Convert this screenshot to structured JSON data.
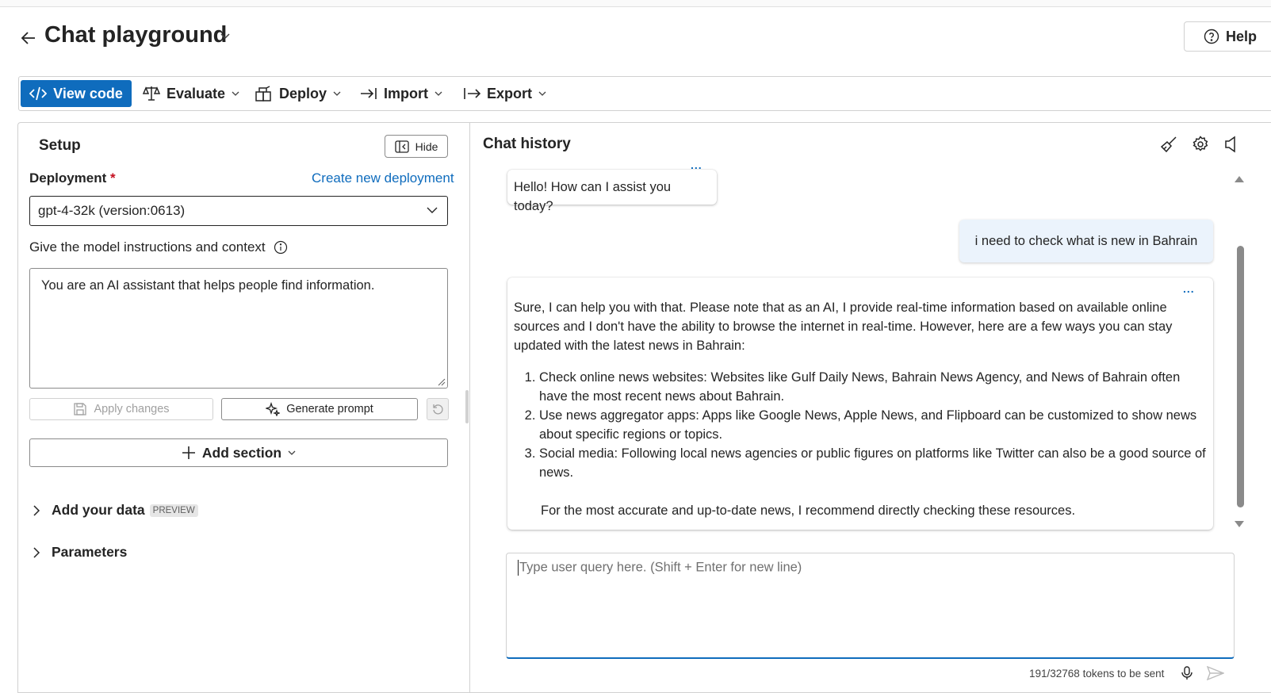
{
  "header": {
    "title": "Chat playground",
    "help_label": "Help"
  },
  "toolbar": {
    "view_code": "View code",
    "evaluate": "Evaluate",
    "deploy": "Deploy",
    "import": "Import",
    "export": "Export"
  },
  "setup": {
    "title": "Setup",
    "hide_label": "Hide",
    "deployment_label": "Deployment",
    "required_mark": "*",
    "create_link": "Create new deployment",
    "deployment_value": "gpt-4-32k (version:0613)",
    "instructions_label": "Give the model instructions and context",
    "system_message": "You are an AI assistant that helps people find information.",
    "apply_changes": "Apply changes",
    "generate_prompt": "Generate prompt",
    "add_section": "Add section",
    "add_your_data": "Add your data",
    "preview_badge": "PREVIEW",
    "parameters": "Parameters"
  },
  "chat": {
    "title": "Chat history",
    "messages": [
      {
        "role": "assistant",
        "text": "Hello! How can I assist you today?"
      },
      {
        "role": "user",
        "text": "i need to check what is new in Bahrain"
      },
      {
        "role": "assistant",
        "intro": "Sure, I can help you with that. Please note that as an AI, I provide real-time information based on available online sources and I don't have the ability to browse the internet in real-time. However, here are a few ways you can stay updated with the latest news in Bahrain:",
        "items": [
          "Check online news websites: Websites like Gulf Daily News, Bahrain News Agency, and News of Bahrain often have the most recent news about Bahrain.",
          "Use news aggregator apps: Apps like Google News, Apple News, and Flipboard can be customized to show news about specific regions or topics.",
          "Social media: Following local news agencies or public figures on platforms like Twitter can also be a good source of news."
        ],
        "outro": "For the most accurate and up-to-date news, I recommend directly checking these resources."
      }
    ],
    "more_label": "...",
    "query_placeholder": "Type user query here. (Shift + Enter for new line)",
    "token_count": "191/32768 tokens to be sent"
  },
  "colors": {
    "accent": "#0f6cbd",
    "user_bubble": "#ebf3fc",
    "required": "#c50f1f"
  }
}
